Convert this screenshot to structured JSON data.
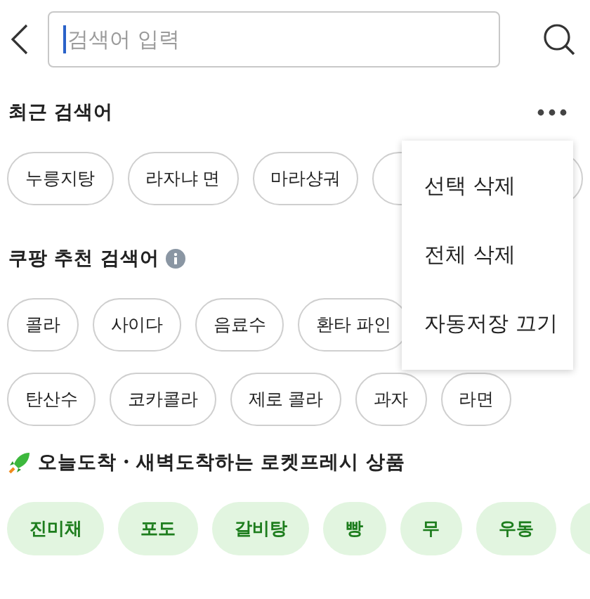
{
  "search": {
    "placeholder": "검색어 입력"
  },
  "sections": [
    {
      "kind": "recent",
      "title": "최근 검색어",
      "rows": [
        [
          "누릉지탕",
          "라자냐 면",
          "마라샹궈"
        ]
      ]
    },
    {
      "kind": "recommended",
      "title": "쿠팡 추천 검색어",
      "rows": [
        [
          "콜라",
          "사이다",
          "음료수",
          "환타 파인"
        ],
        [
          "탄산수",
          "코카콜라",
          "제로 콜라",
          "과자",
          "라면"
        ]
      ]
    },
    {
      "kind": "fresh",
      "title": "오늘도착・새벽도착하는 로켓프레시 상품",
      "rows": [
        [
          "진미채",
          "포도",
          "갈비탕",
          "빵",
          "무",
          "우동"
        ]
      ]
    }
  ],
  "menu": {
    "items": [
      "선택 삭제",
      "전체 삭제",
      "자동저장 끄기"
    ]
  }
}
